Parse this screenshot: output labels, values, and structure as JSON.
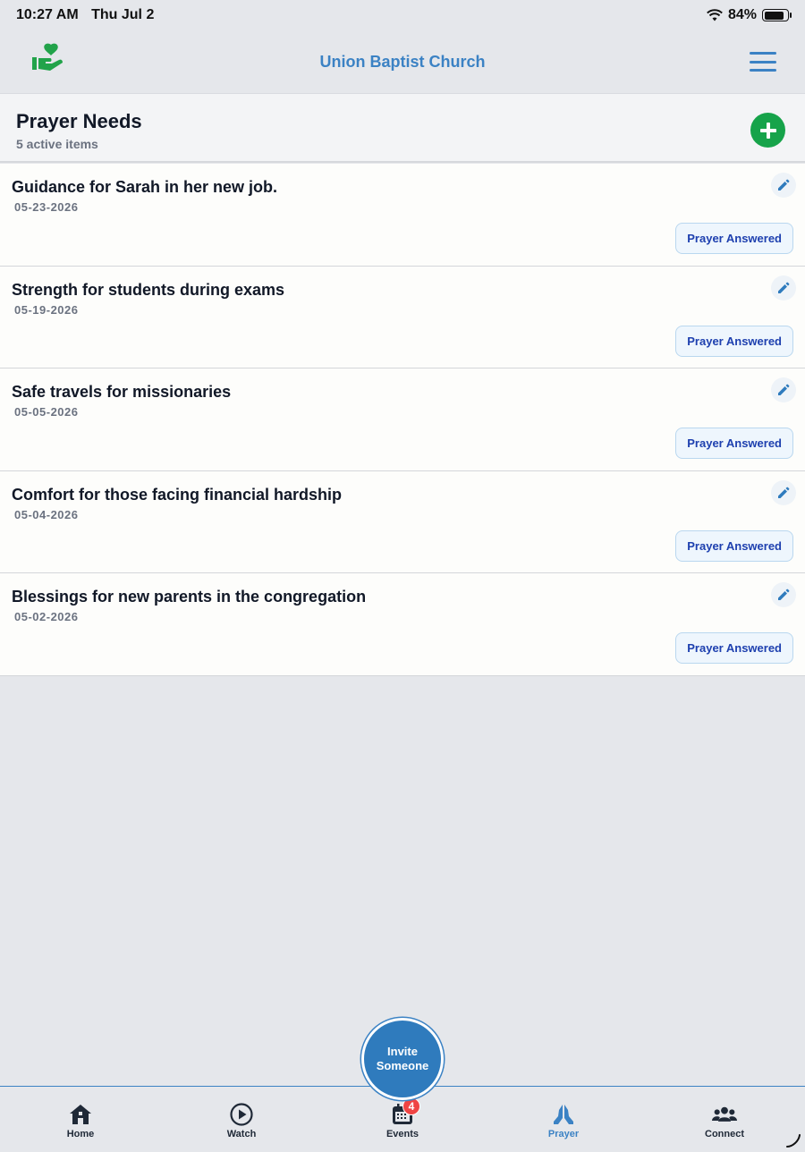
{
  "status_bar": {
    "time": "10:27 AM",
    "date": "Thu Jul 2",
    "battery": "84%"
  },
  "header": {
    "title": "Union Baptist Church"
  },
  "section": {
    "title": "Prayer Needs",
    "subtitle": "5 active items"
  },
  "prayers": [
    {
      "title": "Guidance for Sarah in her new job.",
      "date": "05-23-2026",
      "action": "Prayer Answered"
    },
    {
      "title": "Strength for students during exams",
      "date": "05-19-2026",
      "action": "Prayer Answered"
    },
    {
      "title": "Safe travels for missionaries",
      "date": "05-05-2026",
      "action": "Prayer Answered"
    },
    {
      "title": "Comfort for those facing financial hardship",
      "date": "05-04-2026",
      "action": "Prayer Answered"
    },
    {
      "title": "Blessings for new parents in the congregation",
      "date": "05-02-2026",
      "action": "Prayer Answered"
    }
  ],
  "invite": {
    "label": "Invite Someone"
  },
  "tabs": [
    {
      "label": "Home",
      "icon": "home-icon"
    },
    {
      "label": "Watch",
      "icon": "play-circle-icon"
    },
    {
      "label": "Events",
      "icon": "calendar-icon",
      "badge": "4"
    },
    {
      "label": "Prayer",
      "icon": "praying-hands-icon",
      "active": true
    },
    {
      "label": "Connect",
      "icon": "people-icon"
    }
  ],
  "colors": {
    "brand": "#3b82c4",
    "add": "#16a34a",
    "badge": "#ef4444",
    "logo": "#22a34a"
  }
}
